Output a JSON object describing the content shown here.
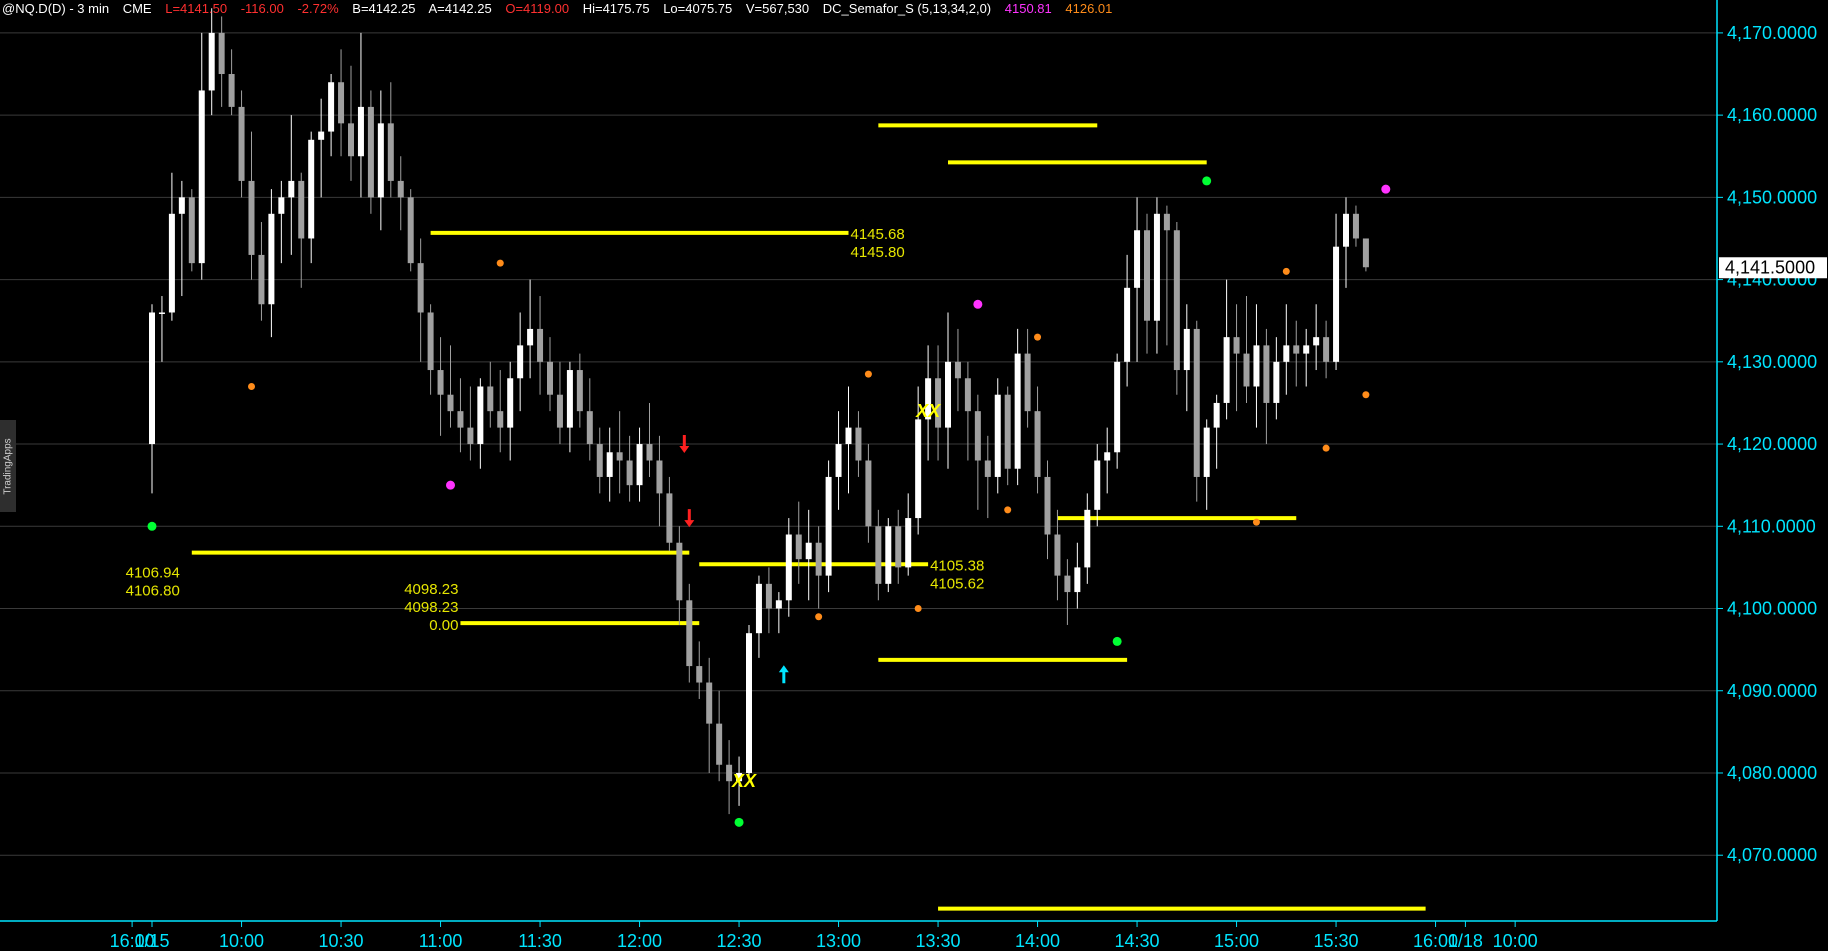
{
  "header": {
    "symbol": "@NQ.D(D) - 3 min",
    "exchange": "CME",
    "last": "L=4141.50",
    "change": "-116.00",
    "change_pct": "-2.72%",
    "bid": "B=4142.25",
    "ask": "A=4142.25",
    "open": "O=4119.00",
    "high": "Hi=4175.75",
    "low": "Lo=4075.75",
    "volume": "V=567,530",
    "indicator": "DC_Semafor_S (5,13,34,2,0)",
    "ind_val1": "4150.81",
    "ind_val2": "4126.01"
  },
  "side_tab": {
    "label": "TradingApps"
  },
  "colors": {
    "background": "#000000",
    "axis": "#00e5ff",
    "grid": "#3a3a3a",
    "candle_up": "#ffffff",
    "candle_down": "#a0a0a0",
    "level_line": "#ffff00",
    "annotation_text": "#e6e600",
    "semafor_green": "#00ff33",
    "semafor_orange": "#ff8c1a",
    "semafor_magenta": "#ff33ff",
    "arrow_sell": "#ff2020",
    "arrow_buy": "#00e5ff",
    "last_price_bg": "#ffffff",
    "header_red": "#ff3030",
    "header_magenta": "#ff33ff",
    "header_orange": "#ff8c1a"
  },
  "chart_data": {
    "type": "candlestick",
    "interval": "3 min",
    "ylim": [
      4062,
      4174
    ],
    "y_ticks": [
      4070,
      4080,
      4090,
      4100,
      4110,
      4120,
      4130,
      4140,
      4150,
      4160,
      4170
    ],
    "y_tick_labels": [
      "4,070.0000",
      "4,080.0000",
      "4,090.0000",
      "4,100.0000",
      "4,110.0000",
      "4,120.0000",
      "4,130.0000",
      "4,140.0000",
      "4,150.0000",
      "4,160.0000",
      "4,170.0000"
    ],
    "last_price": 4141.5,
    "last_price_label": "4,141.5000",
    "x_labels": [
      {
        "label": "16:00",
        "x": -2
      },
      {
        "label": "1/15",
        "x": 0
      },
      {
        "label": "10:00",
        "x": 9
      },
      {
        "label": "10:30",
        "x": 19
      },
      {
        "label": "11:00",
        "x": 29
      },
      {
        "label": "11:30",
        "x": 39
      },
      {
        "label": "12:00",
        "x": 49
      },
      {
        "label": "12:30",
        "x": 59
      },
      {
        "label": "13:00",
        "x": 69
      },
      {
        "label": "13:30",
        "x": 79
      },
      {
        "label": "14:00",
        "x": 89
      },
      {
        "label": "14:30",
        "x": 99
      },
      {
        "label": "15:00",
        "x": 109
      },
      {
        "label": "15:30",
        "x": 119
      },
      {
        "label": "16:00",
        "x": 129
      },
      {
        "label": "1/18",
        "x": 132
      },
      {
        "label": "10:00",
        "x": 137
      }
    ],
    "candles": [
      [
        4120,
        4137,
        4114,
        4136
      ],
      [
        4136,
        4138,
        4130,
        4136
      ],
      [
        4136,
        4153,
        4135,
        4148
      ],
      [
        4148,
        4152,
        4138,
        4150
      ],
      [
        4150,
        4151,
        4141,
        4142
      ],
      [
        4142,
        4170,
        4140,
        4163
      ],
      [
        4163,
        4173,
        4160,
        4170
      ],
      [
        4170,
        4172,
        4161,
        4165
      ],
      [
        4165,
        4168,
        4160,
        4161
      ],
      [
        4161,
        4163,
        4150,
        4152
      ],
      [
        4152,
        4158,
        4140,
        4143
      ],
      [
        4143,
        4147,
        4135,
        4137
      ],
      [
        4137,
        4151,
        4133,
        4148
      ],
      [
        4148,
        4152,
        4142,
        4150
      ],
      [
        4150,
        4160,
        4143,
        4152
      ],
      [
        4152,
        4153,
        4139,
        4145
      ],
      [
        4145,
        4158,
        4142,
        4157
      ],
      [
        4157,
        4162,
        4150,
        4158
      ],
      [
        4158,
        4165,
        4155,
        4164
      ],
      [
        4164,
        4168,
        4155,
        4159
      ],
      [
        4159,
        4166,
        4152,
        4155
      ],
      [
        4155,
        4170,
        4150,
        4161
      ],
      [
        4161,
        4163,
        4148,
        4150
      ],
      [
        4150,
        4163,
        4146,
        4159
      ],
      [
        4159,
        4164,
        4150,
        4152
      ],
      [
        4152,
        4155,
        4146,
        4150
      ],
      [
        4150,
        4151,
        4141,
        4142
      ],
      [
        4142,
        4145,
        4130,
        4136
      ],
      [
        4136,
        4137,
        4126,
        4129
      ],
      [
        4129,
        4133,
        4121,
        4126
      ],
      [
        4126,
        4132,
        4122,
        4124
      ],
      [
        4124,
        4128,
        4119,
        4122
      ],
      [
        4122,
        4127,
        4118,
        4120
      ],
      [
        4120,
        4128,
        4117,
        4127
      ],
      [
        4127,
        4130,
        4122,
        4124
      ],
      [
        4124,
        4129,
        4119,
        4122
      ],
      [
        4122,
        4130,
        4118,
        4128
      ],
      [
        4128,
        4136,
        4124,
        4132
      ],
      [
        4132,
        4140,
        4128,
        4134
      ],
      [
        4134,
        4138,
        4126,
        4130
      ],
      [
        4130,
        4133,
        4124,
        4126
      ],
      [
        4126,
        4130,
        4120,
        4122
      ],
      [
        4122,
        4130,
        4119,
        4129
      ],
      [
        4129,
        4131,
        4122,
        4124
      ],
      [
        4124,
        4128,
        4118,
        4120
      ],
      [
        4120,
        4122,
        4114,
        4116
      ],
      [
        4116,
        4122,
        4113,
        4119
      ],
      [
        4119,
        4124,
        4114,
        4118
      ],
      [
        4118,
        4121,
        4113,
        4115
      ],
      [
        4115,
        4122,
        4113,
        4120
      ],
      [
        4120,
        4125,
        4116,
        4118
      ],
      [
        4118,
        4121,
        4110,
        4114
      ],
      [
        4114,
        4116,
        4107,
        4108
      ],
      [
        4108,
        4110,
        4098,
        4101
      ],
      [
        4101,
        4103,
        4091,
        4093
      ],
      [
        4093,
        4096,
        4089,
        4091
      ],
      [
        4091,
        4094,
        4080,
        4086
      ],
      [
        4086,
        4090,
        4079,
        4081
      ],
      [
        4081,
        4084,
        4075,
        4079
      ],
      [
        4079,
        4082,
        4076,
        4080
      ],
      [
        4080,
        4098,
        4079,
        4097
      ],
      [
        4097,
        4104,
        4094,
        4103
      ],
      [
        4103,
        4105,
        4097,
        4100
      ],
      [
        4100,
        4102,
        4097,
        4101
      ],
      [
        4101,
        4111,
        4099,
        4109
      ],
      [
        4109,
        4113,
        4103,
        4106
      ],
      [
        4106,
        4112,
        4101,
        4108
      ],
      [
        4108,
        4110,
        4100,
        4104
      ],
      [
        4104,
        4118,
        4102,
        4116
      ],
      [
        4116,
        4124,
        4112,
        4120
      ],
      [
        4120,
        4127,
        4114,
        4122
      ],
      [
        4122,
        4124,
        4116,
        4118
      ],
      [
        4118,
        4120,
        4108,
        4110
      ],
      [
        4110,
        4112,
        4101,
        4103
      ],
      [
        4103,
        4111,
        4102,
        4110
      ],
      [
        4110,
        4112,
        4103,
        4105
      ],
      [
        4105,
        4114,
        4104,
        4111
      ],
      [
        4111,
        4127,
        4109,
        4123
      ],
      [
        4123,
        4132,
        4118,
        4128
      ],
      [
        4128,
        4132,
        4118,
        4122
      ],
      [
        4122,
        4136,
        4117,
        4130
      ],
      [
        4130,
        4134,
        4124,
        4128
      ],
      [
        4128,
        4130,
        4118,
        4124
      ],
      [
        4124,
        4126,
        4112,
        4118
      ],
      [
        4118,
        4121,
        4111,
        4116
      ],
      [
        4116,
        4128,
        4114,
        4126
      ],
      [
        4126,
        4127,
        4115,
        4117
      ],
      [
        4117,
        4134,
        4115,
        4131
      ],
      [
        4131,
        4134,
        4122,
        4124
      ],
      [
        4124,
        4127,
        4114,
        4116
      ],
      [
        4116,
        4118,
        4106,
        4109
      ],
      [
        4109,
        4112,
        4101,
        4104
      ],
      [
        4104,
        4106,
        4098,
        4102
      ],
      [
        4102,
        4108,
        4100,
        4105
      ],
      [
        4105,
        4114,
        4103,
        4112
      ],
      [
        4112,
        4120,
        4110,
        4118
      ],
      [
        4118,
        4122,
        4114,
        4119
      ],
      [
        4119,
        4131,
        4117,
        4130
      ],
      [
        4130,
        4143,
        4127,
        4139
      ],
      [
        4139,
        4150,
        4130,
        4146
      ],
      [
        4146,
        4148,
        4131,
        4135
      ],
      [
        4135,
        4150,
        4131,
        4148
      ],
      [
        4148,
        4149,
        4132,
        4146
      ],
      [
        4146,
        4147,
        4126,
        4129
      ],
      [
        4129,
        4137,
        4124,
        4134
      ],
      [
        4134,
        4135,
        4113,
        4116
      ],
      [
        4116,
        4123,
        4112,
        4122
      ],
      [
        4122,
        4126,
        4117,
        4125
      ],
      [
        4125,
        4140,
        4123,
        4133
      ],
      [
        4133,
        4137,
        4124,
        4131
      ],
      [
        4131,
        4138,
        4125,
        4127
      ],
      [
        4127,
        4137,
        4122,
        4132
      ],
      [
        4132,
        4134,
        4120,
        4125
      ],
      [
        4125,
        4133,
        4123,
        4130
      ],
      [
        4130,
        4137,
        4126,
        4132
      ],
      [
        4132,
        4135,
        4127,
        4131
      ],
      [
        4131,
        4134,
        4127,
        4132
      ],
      [
        4132,
        4137,
        4129,
        4133
      ],
      [
        4133,
        4135,
        4128,
        4130
      ],
      [
        4130,
        4148,
        4129,
        4144
      ],
      [
        4144,
        4150,
        4139,
        4148
      ],
      [
        4148,
        4149,
        4144,
        4145
      ],
      [
        4145,
        4144,
        4141,
        4141.5
      ]
    ],
    "level_lines": [
      {
        "y": 4145.68,
        "x1": 28,
        "x2": 70
      },
      {
        "y": 4158.75,
        "x1": 73,
        "x2": 95
      },
      {
        "y": 4154.25,
        "x1": 80,
        "x2": 106
      },
      {
        "y": 4106.8,
        "x1": 4,
        "x2": 54
      },
      {
        "y": 4105.38,
        "x1": 55,
        "x2": 78
      },
      {
        "y": 4098.23,
        "x1": 31,
        "x2": 55
      },
      {
        "y": 4093.75,
        "x1": 73,
        "x2": 98
      },
      {
        "y": 4111.0,
        "x1": 91,
        "x2": 115
      },
      {
        "y": 4063.5,
        "x1": 79,
        "x2": 128
      }
    ],
    "level_labels": [
      {
        "lines": [
          "4145.68",
          "4145.80"
        ],
        "x": 70,
        "y": 4145.68,
        "align": "start"
      },
      {
        "lines": [
          "4106.94",
          "4106.80"
        ],
        "x": 3,
        "y": 4104.5,
        "align": "end"
      },
      {
        "lines": [
          "4098.23",
          "4098.23",
          "0.00"
        ],
        "x": 31,
        "y": 4102.5,
        "align": "end"
      },
      {
        "lines": [
          "4105.38",
          "4105.62"
        ],
        "x": 78,
        "y": 4105.38,
        "align": "start"
      }
    ],
    "semafor_dots": [
      {
        "x": 0,
        "y": 4110,
        "color": "green"
      },
      {
        "x": 10,
        "y": 4127,
        "color": "orange"
      },
      {
        "x": 30,
        "y": 4115,
        "color": "magenta"
      },
      {
        "x": 35,
        "y": 4142,
        "color": "orange"
      },
      {
        "x": 59,
        "y": 4074,
        "color": "green"
      },
      {
        "x": 67,
        "y": 4099,
        "color": "orange"
      },
      {
        "x": 72,
        "y": 4128.5,
        "color": "orange"
      },
      {
        "x": 77,
        "y": 4100,
        "color": "orange"
      },
      {
        "x": 83,
        "y": 4137,
        "color": "magenta"
      },
      {
        "x": 86,
        "y": 4112,
        "color": "orange"
      },
      {
        "x": 89,
        "y": 4133,
        "color": "orange"
      },
      {
        "x": 97,
        "y": 4096,
        "color": "green"
      },
      {
        "x": 106,
        "y": 4152,
        "color": "green"
      },
      {
        "x": 111,
        "y": 4110.5,
        "color": "orange"
      },
      {
        "x": 114,
        "y": 4141,
        "color": "orange"
      },
      {
        "x": 118,
        "y": 4119.5,
        "color": "orange"
      },
      {
        "x": 122,
        "y": 4126,
        "color": "orange"
      },
      {
        "x": 124,
        "y": 4151,
        "color": "magenta"
      }
    ],
    "arrows": [
      {
        "x": 53.5,
        "y": 4120,
        "direction": "down",
        "color": "red"
      },
      {
        "x": 54,
        "y": 4111,
        "direction": "down",
        "color": "red"
      },
      {
        "x": 63.5,
        "y": 4092,
        "direction": "up",
        "color": "cyan"
      }
    ],
    "markers": [
      {
        "text": "XX",
        "x": 59.5,
        "y": 4079
      },
      {
        "text": "XX",
        "x": 78,
        "y": 4124
      }
    ]
  }
}
